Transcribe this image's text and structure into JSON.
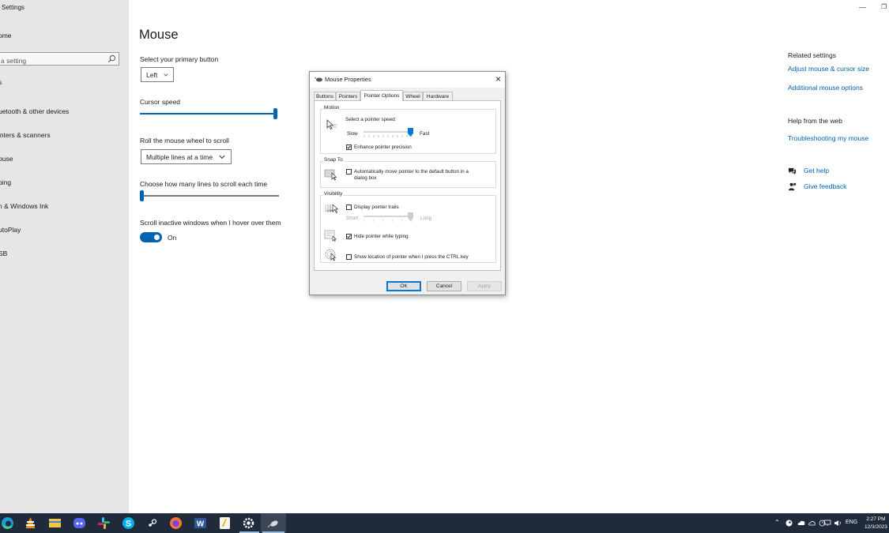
{
  "settings": {
    "app_title": "Settings",
    "sidebar": {
      "home": "ome",
      "search_placeholder": "a setting",
      "items": [
        {
          "label": "s"
        },
        {
          "label": "uetooth & other devices"
        },
        {
          "label": "inters & scanners"
        },
        {
          "label": "ouse"
        },
        {
          "label": "ping"
        },
        {
          "label": "n & Windows Ink"
        },
        {
          "label": "utoPlay"
        },
        {
          "label": "SB"
        }
      ]
    },
    "main": {
      "title": "Mouse",
      "primary_button": {
        "label": "Select your primary button",
        "value": "Left"
      },
      "cursor_speed": {
        "label": "Cursor speed",
        "level": 1.0
      },
      "scroll": {
        "label": "Roll the mouse wheel to scroll",
        "value": "Multiple lines at a time"
      },
      "lines": {
        "label": "Choose how many lines to scroll each time",
        "level": 0.0
      },
      "inactive": {
        "label": "Scroll inactive windows when I hover over them",
        "state": "On"
      }
    },
    "related": {
      "title": "Related settings",
      "links": [
        "Adjust mouse & cursor size",
        "Additional mouse options"
      ]
    },
    "help": {
      "title": "Help from the web",
      "link": "Troubleshooting my mouse"
    },
    "support": {
      "get_help": "Get help",
      "feedback": "Give feedback"
    }
  },
  "dialog": {
    "title": "Mouse Properties",
    "tabs": [
      "Buttons",
      "Pointers",
      "Pointer Options",
      "Wheel",
      "Hardware"
    ],
    "active_tab": "Pointer Options",
    "motion": {
      "group": "Motion",
      "prompt": "Select a pointer speed:",
      "slow": "Slow",
      "fast": "Fast",
      "speed_level": 1.0,
      "precision_label": "Enhance pointer precision",
      "precision_checked": true
    },
    "snap": {
      "group": "Snap To",
      "line1": "Automatically move pointer to the default button in a",
      "line2": "dialog box",
      "checked": false
    },
    "visibility": {
      "group": "Visibility",
      "trails_label": "Display pointer trails",
      "trails_checked": false,
      "short": "Short",
      "long": "Long",
      "trails_level": 1.0,
      "hide_label": "Hide pointer while typing",
      "hide_checked": true,
      "ctrl_label": "Show location of pointer when I press the CTRL key",
      "ctrl_checked": false
    },
    "buttons": {
      "ok": "OK",
      "cancel": "Cancel",
      "apply": "Apply"
    }
  },
  "taskbar": {
    "icons": [
      "edge-icon",
      "vlc-icon",
      "file-explorer-icon",
      "discord-icon",
      "slack-icon",
      "skype-icon",
      "steam-icon",
      "firefox-icon",
      "word-icon",
      "sticky-app-icon",
      "settings-icon",
      "mouse-properties-icon"
    ],
    "language": "ENG",
    "time": "2:27 PM",
    "date": "12/3/2023"
  },
  "colors": {
    "accent": "#0063b1",
    "link": "#0063b1",
    "sidebar_bg": "#e6e6e6",
    "taskbar_bg": "#1f2a3a"
  }
}
